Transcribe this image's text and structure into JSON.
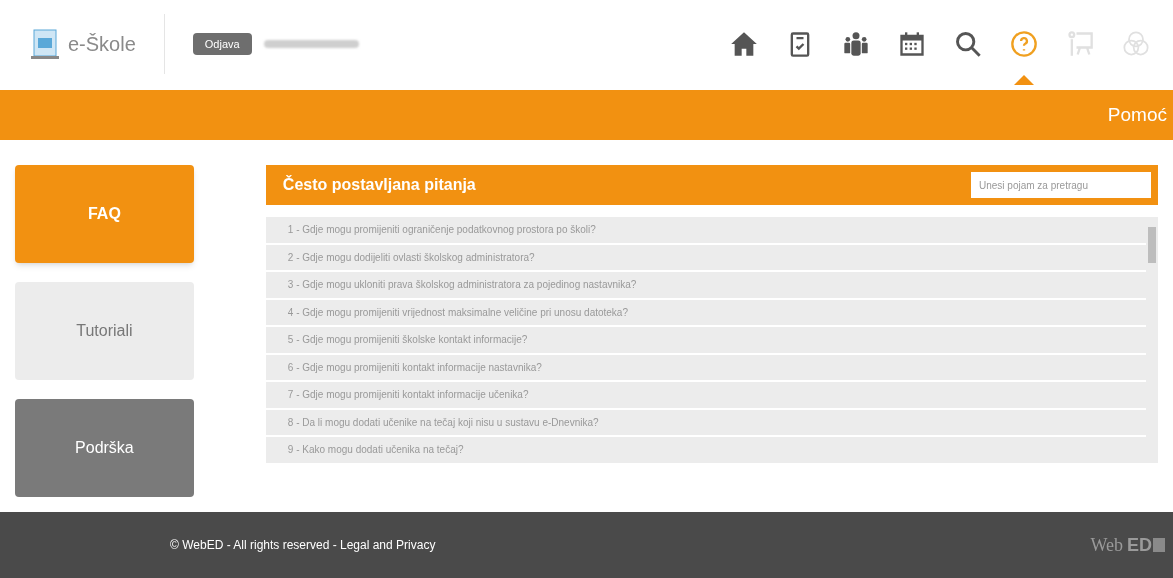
{
  "header": {
    "app_name": "e-Škole",
    "logout_button": "Odjava",
    "nav": [
      {
        "kind": "home",
        "selected": false,
        "disabled": false
      },
      {
        "kind": "clipboard",
        "selected": false,
        "disabled": false
      },
      {
        "kind": "group",
        "selected": false,
        "disabled": false
      },
      {
        "kind": "calendar",
        "selected": false,
        "disabled": false
      },
      {
        "kind": "search",
        "selected": false,
        "disabled": false
      },
      {
        "kind": "help",
        "selected": true,
        "disabled": false
      },
      {
        "kind": "presenter",
        "selected": false,
        "disabled": true
      },
      {
        "kind": "rings",
        "selected": false,
        "disabled": true
      }
    ]
  },
  "section_title": "Pomoć",
  "sidebar": {
    "items": [
      {
        "label": "FAQ",
        "selected": true,
        "color": "#f29111"
      },
      {
        "label": "Tutoriali",
        "selected": false,
        "color": "#ececec"
      },
      {
        "label": "Podrška",
        "selected": false,
        "color": "#7a7a7a"
      }
    ]
  },
  "faq": {
    "title": "Često postavljana pitanja",
    "search": {
      "placeholder": "Unesi pojam za pretragu"
    },
    "questions": [
      "1 - Gdje mogu promijeniti ograničenje podatkovnog prostora po školi?",
      "2 - Gdje mogu dodijeliti ovlasti školskog administratora?",
      "3 - Gdje mogu ukloniti prava školskog administratora za pojedinog nastavnika?",
      "4 - Gdje mogu promijeniti vrijednost maksimalne veličine pri unosu datoteka?",
      "5 - Gdje mogu promijeniti školske kontakt informacije?",
      "6 - Gdje mogu promijeniti kontakt informacije nastavnika?",
      "7 - Gdje mogu promijeniti kontakt informacije učenika?",
      "8 - Da li mogu dodati učenike na tečaj koji nisu u sustavu e-Dnevnika?",
      "9 - Kako mogu dodati učenika na tečaj?"
    ]
  },
  "footer": {
    "text": "© WebED - All rights reserved - Legal and Privacy",
    "logo_left": "Web",
    "logo_right": "ED"
  }
}
